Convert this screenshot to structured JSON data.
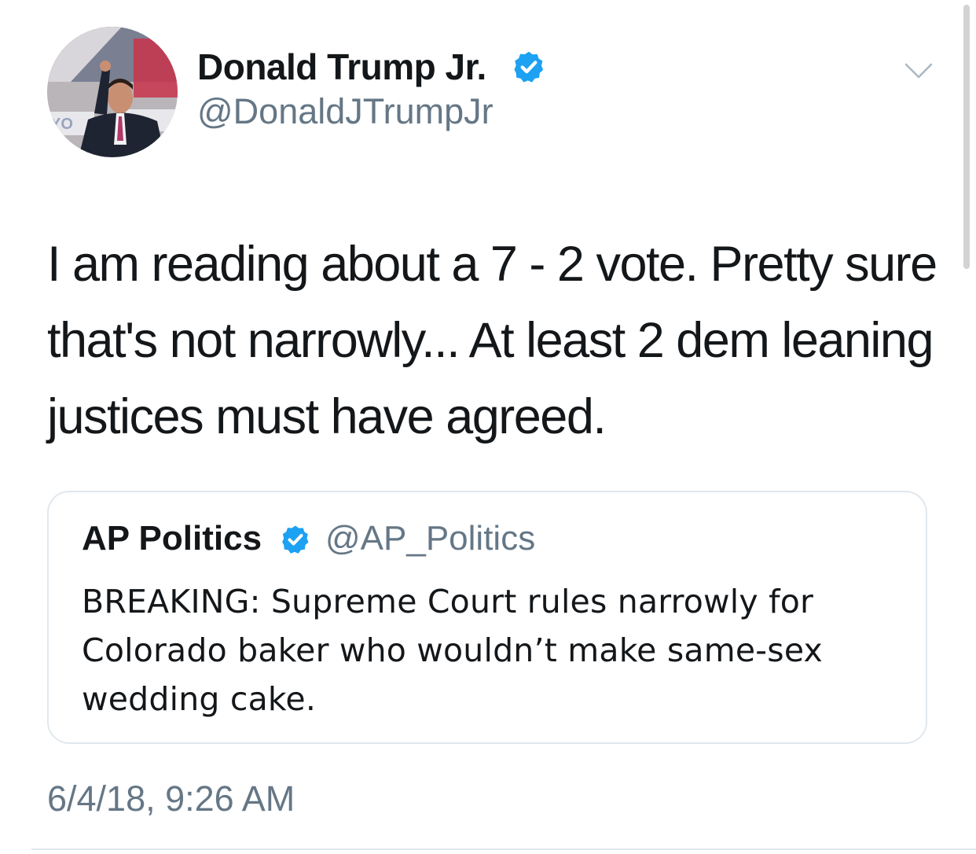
{
  "author": {
    "display_name": "Donald Trump Jr.",
    "handle": "@DonaldJTrumpJr",
    "verified": true,
    "avatar_icon": "profile-photo"
  },
  "tweet": {
    "text": "I am reading about a 7 - 2 vote. Pretty sure that's not narrowly... At least 2 dem leaning justices must have agreed.",
    "timestamp": "6/4/18, 9:26 AM"
  },
  "quoted_tweet": {
    "display_name": "AP Politics",
    "handle": "@AP_Politics",
    "verified": true,
    "text": "BREAKING: Supreme Court rules narrowly for Colorado baker who wouldn’t make same-sex wedding cake."
  },
  "icons": {
    "verified": "verified-badge-icon",
    "menu": "chevron-down-icon"
  },
  "colors": {
    "primary_text": "#14171a",
    "secondary_text": "#657786",
    "verified_blue": "#1da1f2",
    "border": "#e1e8ed"
  }
}
